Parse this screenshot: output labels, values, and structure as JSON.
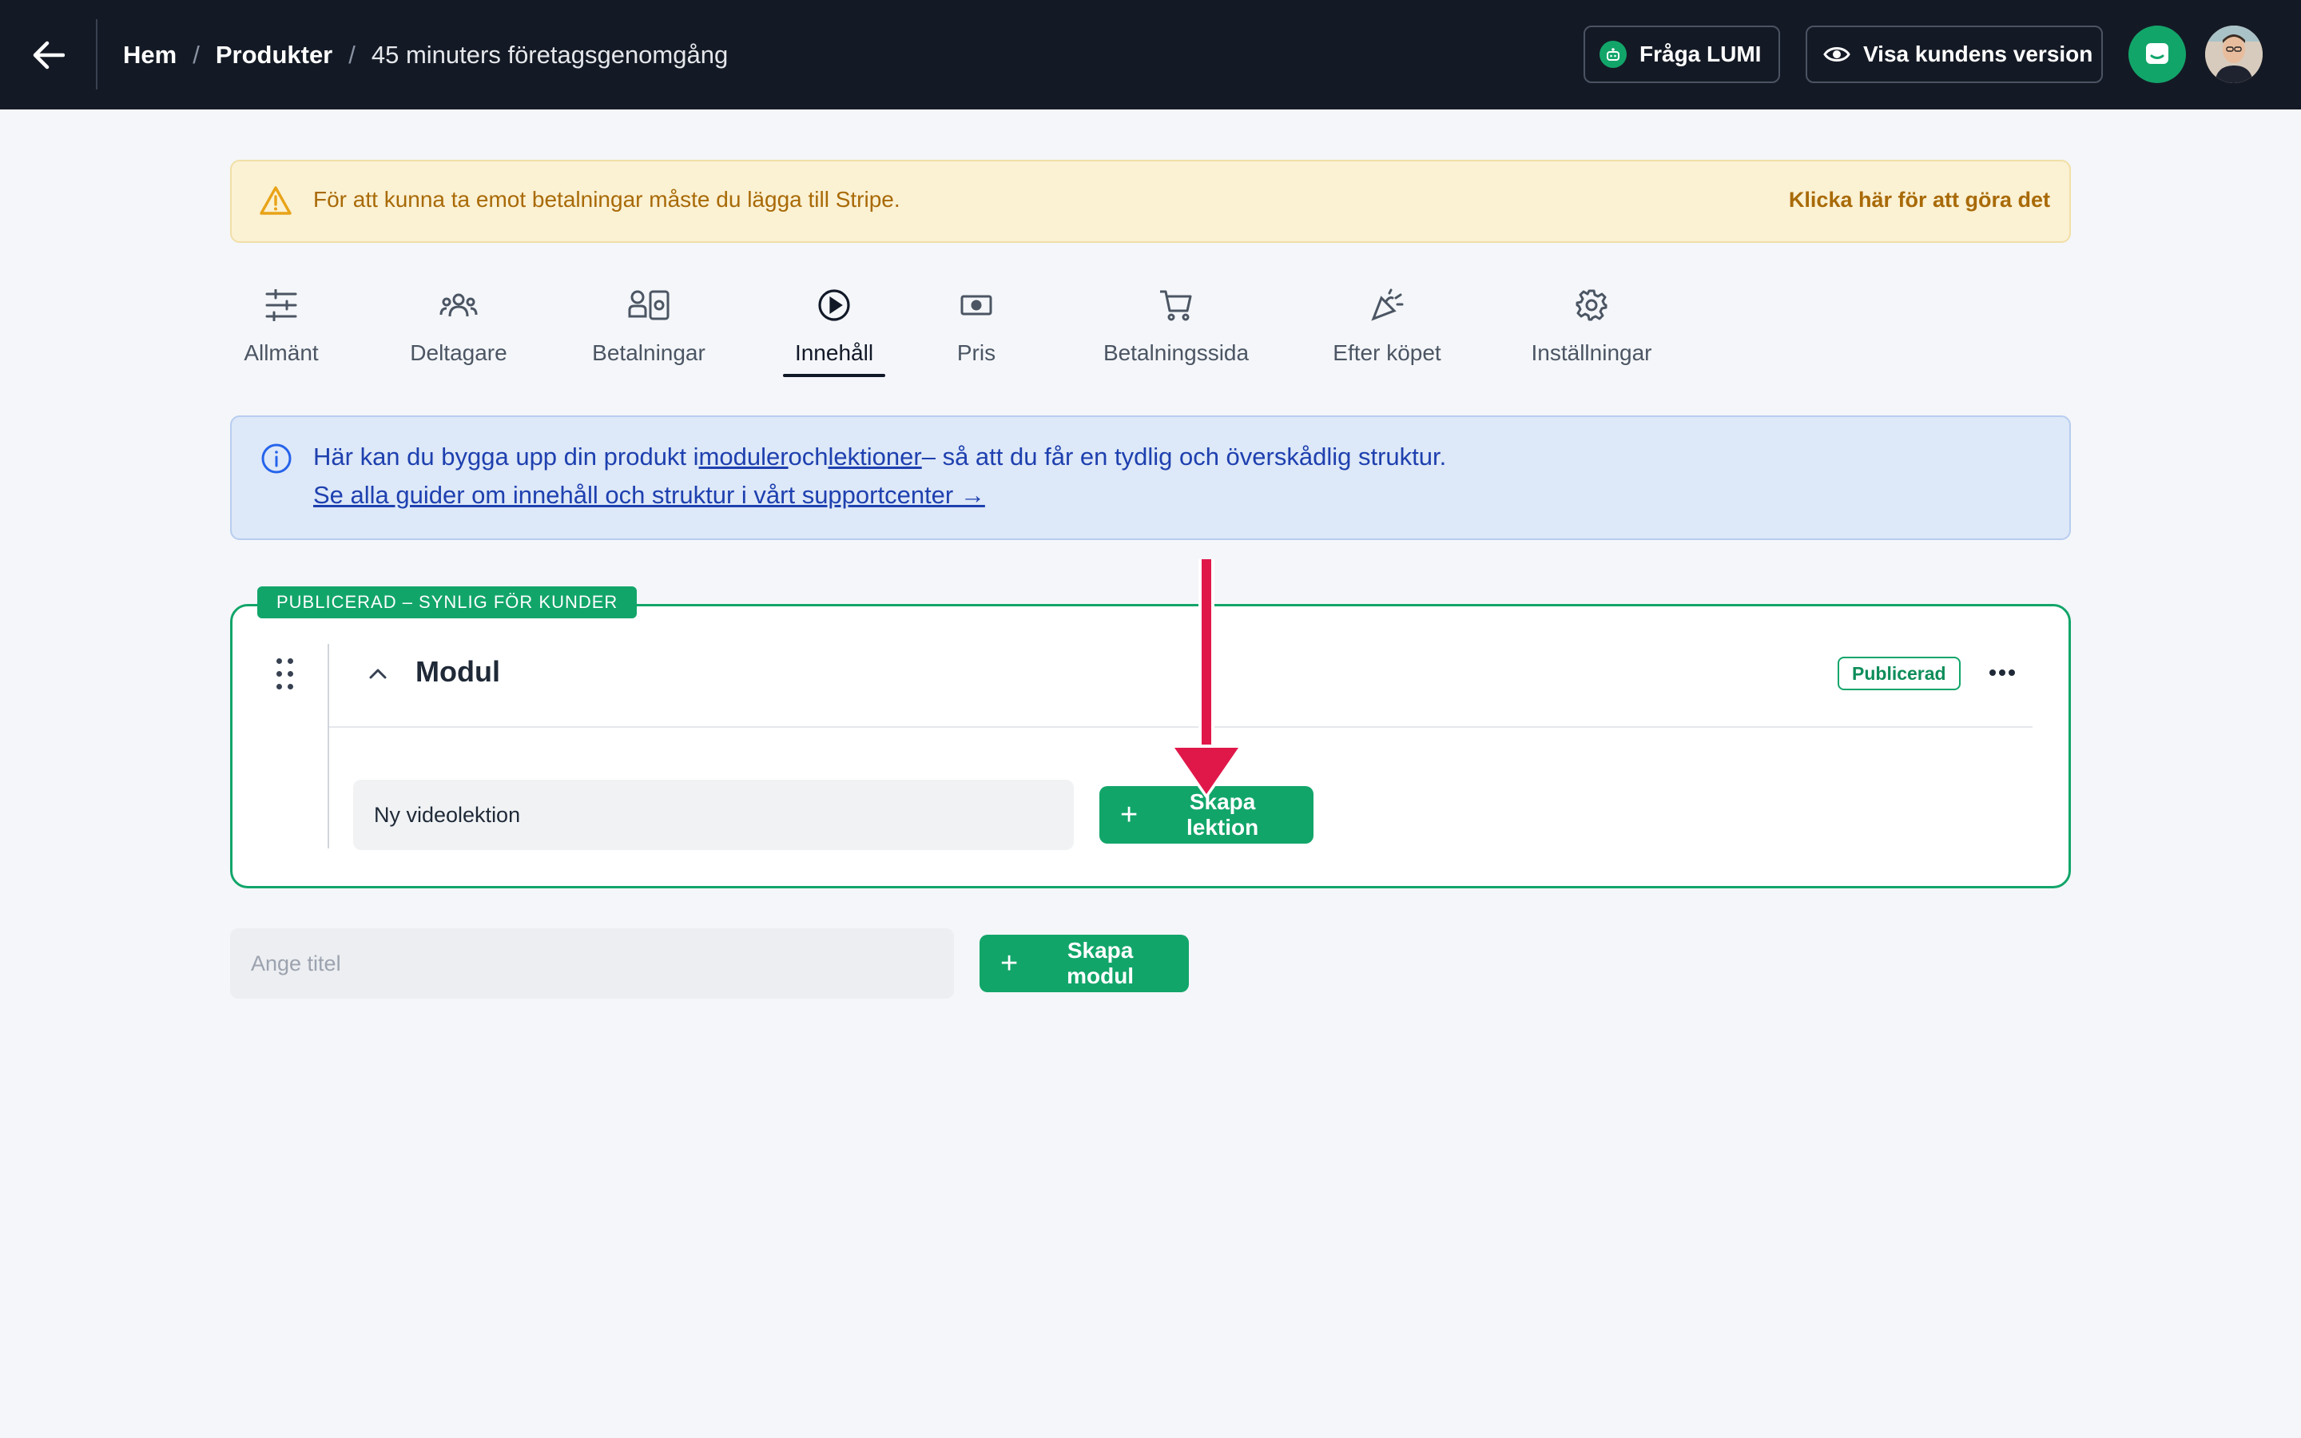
{
  "header": {
    "breadcrumb": {
      "home": "Hem",
      "separator": "/",
      "products": "Produkter",
      "current": "45 minuters företagsgenomgång"
    },
    "ask_lumi_label": "Fråga LUMI",
    "preview_label": "Visa kundens version"
  },
  "alert": {
    "message": "För att kunna ta emot betalningar måste du lägga till Stripe.",
    "action": "Klicka här för att göra det"
  },
  "tabs": [
    {
      "label": "Allmänt",
      "icon": "sliders-icon"
    },
    {
      "label": "Deltagare",
      "icon": "users-icon"
    },
    {
      "label": "Betalningar",
      "icon": "payments-icon"
    },
    {
      "label": "Innehåll",
      "icon": "play-circle-icon",
      "active": true
    },
    {
      "label": "Pris",
      "icon": "banknote-icon"
    },
    {
      "label": "Betalningssida",
      "icon": "cart-icon"
    },
    {
      "label": "Efter köpet",
      "icon": "party-icon"
    },
    {
      "label": "Inställningar",
      "icon": "gear-icon"
    }
  ],
  "info": {
    "text_before": "Här kan du bygga upp din produkt i",
    "link_modules": "moduler",
    "text_and": "och",
    "link_lessons": "lektioner",
    "text_after": "– så att du får en tydlig och överskådlig struktur.",
    "guide_link": "Se alla guider om innehåll och struktur i vårt supportcenter →"
  },
  "module": {
    "published_tag": "PUBLICERAD – SYNLIG FÖR KUNDER",
    "title": "Modul",
    "status": "Publicerad",
    "lesson_input_value": "Ny videolektion",
    "create_lesson_label": "Skapa lektion"
  },
  "new_module": {
    "title_placeholder": "Ange titel",
    "create_module_label": "Skapa modul"
  },
  "colors": {
    "header_bg": "#141a25",
    "accent_green": "#12a56a",
    "warning_bg": "#fbf1d3",
    "warning_text": "#a86a07",
    "info_bg": "#dde8f8",
    "info_text": "#1e40af",
    "annotation_arrow": "#e0184a"
  }
}
